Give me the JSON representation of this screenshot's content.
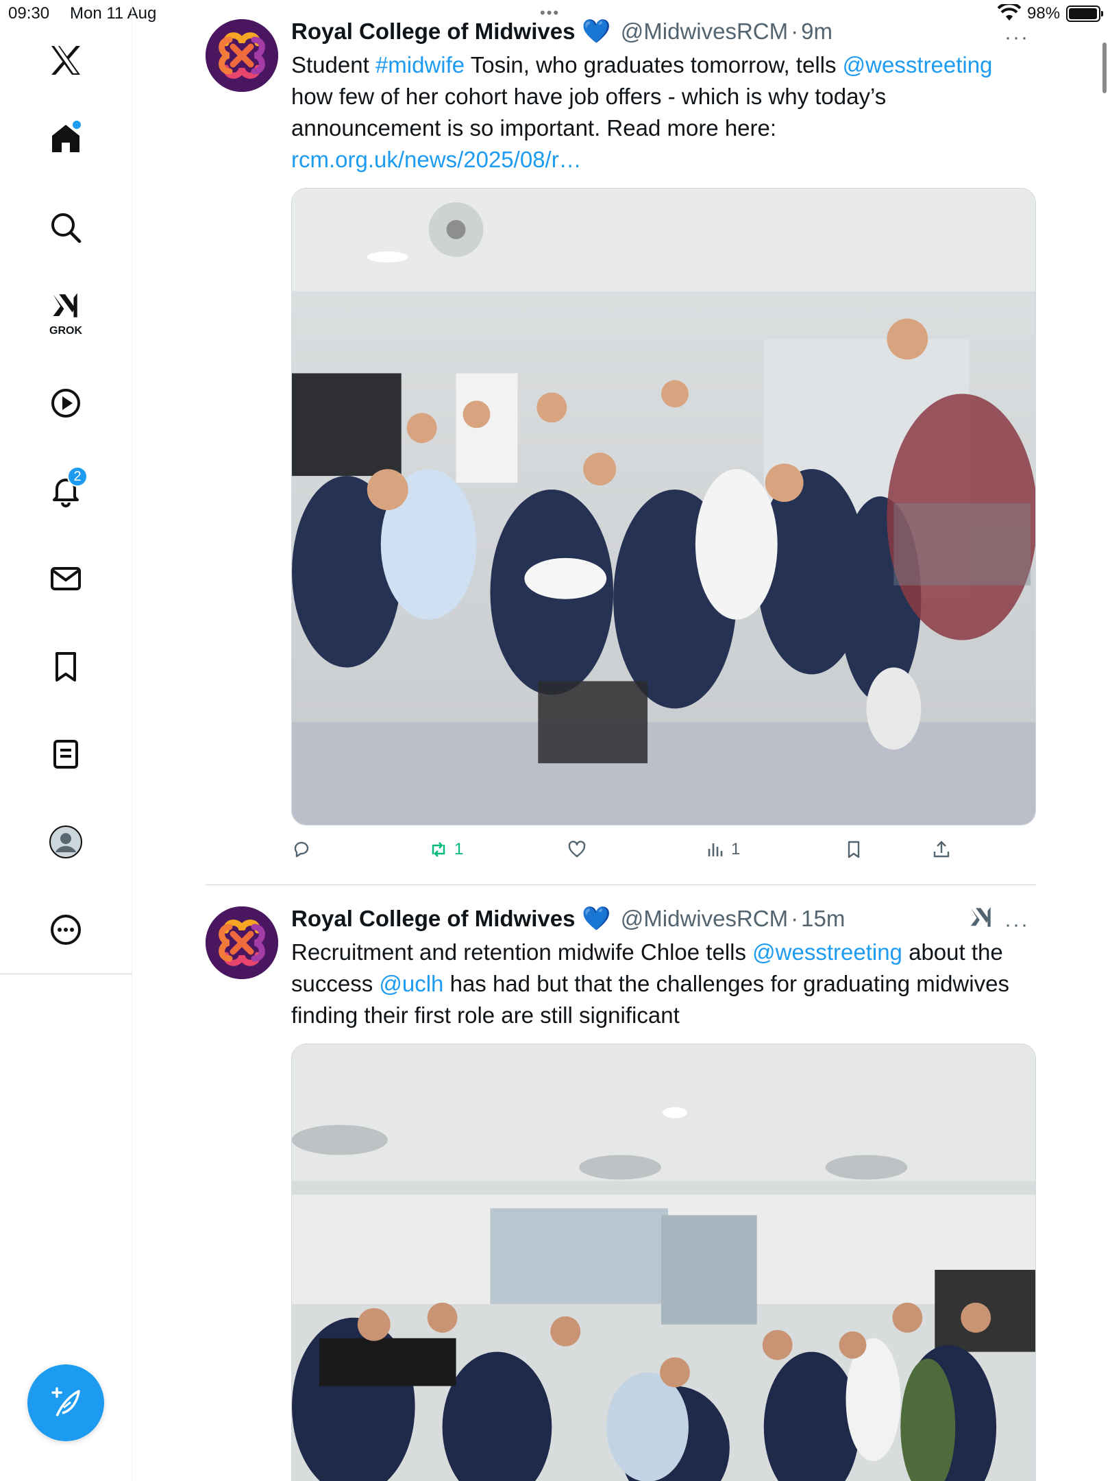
{
  "status_bar": {
    "time": "09:30",
    "date": "Mon 11 Aug",
    "battery_pct": "98%",
    "battery_level": 0.98
  },
  "sidebar": {
    "logo": "x-logo-icon",
    "items": [
      {
        "name": "home",
        "icon": "home-icon",
        "has_dot": true
      },
      {
        "name": "search",
        "icon": "search-icon"
      },
      {
        "name": "grok",
        "icon": "grok-icon",
        "label": "GROK"
      },
      {
        "name": "videos",
        "icon": "play-icon"
      },
      {
        "name": "notifications",
        "icon": "bell-icon",
        "badge": "2"
      },
      {
        "name": "messages",
        "icon": "mail-icon"
      },
      {
        "name": "bookmarks",
        "icon": "bookmark-icon"
      },
      {
        "name": "lists",
        "icon": "list-icon"
      },
      {
        "name": "profile",
        "icon": "avatar-icon"
      },
      {
        "name": "more",
        "icon": "more-icon"
      }
    ],
    "compose_icon": "compose-feather-icon"
  },
  "colors": {
    "accent": "#1d9bf0",
    "retweet": "#00ba7c",
    "secondary_text": "#536471",
    "avatar_bg": "#4a1660"
  },
  "tweets": [
    {
      "name": "Royal College of Midwives",
      "verified": "💙",
      "handle": "@MidwivesRCM",
      "separator": "·",
      "time": "9m",
      "more": "···",
      "text": {
        "p1": "Student ",
        "hashtag": "#midwife",
        "p2": " Tosin, who graduates tomorrow, tells ",
        "mention": "@wesstreeting",
        "p3": " how few of her cohort have job offers - which is why today’s announcement is so important. Read more here: ",
        "url": "rcm.org.uk/news/2025/08/r…"
      },
      "actions": {
        "reply": "",
        "retweet": "1",
        "like": "",
        "views": "1",
        "bookmark": "",
        "share": ""
      }
    },
    {
      "name": "Royal College of Midwives",
      "verified": "💙",
      "handle": "@MidwivesRCM",
      "separator": "·",
      "time": "15m",
      "more": "···",
      "grok_icon": "grok-icon",
      "text": {
        "p1": "Recruitment and retention midwife Chloe tells ",
        "mention1": "@wesstreeting",
        "p2": " about the success ",
        "mention2": "@uclh",
        "p3": " has had but that the challenges for graduating midwives finding their first role are still significant"
      }
    }
  ]
}
